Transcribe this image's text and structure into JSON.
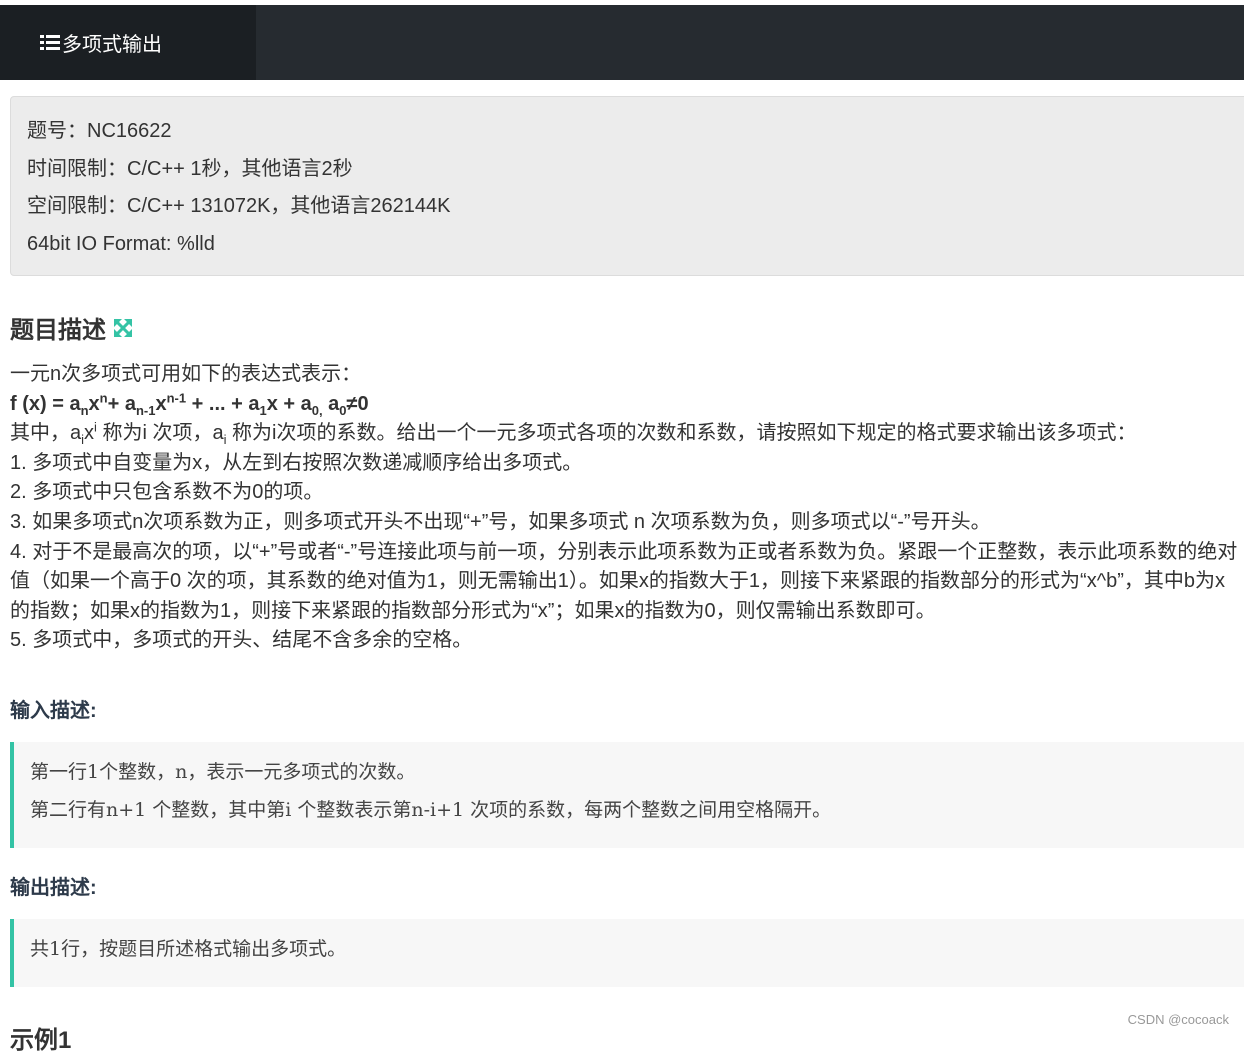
{
  "header": {
    "tab_title": "多项式输出"
  },
  "info": {
    "problem_id": "题号：NC16622",
    "time_limit": "时间限制：C/C++ 1秒，其他语言2秒",
    "memory_limit": "空间限制：C/C++ 131072K，其他语言262144K",
    "io_format": "64bit IO Format: %lld"
  },
  "description": {
    "title": "题目描述",
    "intro": "一元n次多项式可用如下的表达式表示：",
    "formula": {
      "f": "f (x) = a",
      "s1": "n",
      "x1": "x",
      "p1": "n",
      "t1": "+ a",
      "s2": "n-1",
      "x2": "x",
      "p2": "n-1",
      "t2": " + ... + a",
      "s3": "1",
      "t3": "x + a",
      "s4": "0,",
      "t4": " a",
      "s5": "0",
      "t5": "≠0"
    },
    "terms": {
      "a": "其中，a",
      "i1": "i",
      "x": "x",
      "i2": "i",
      "b": " 称为i 次项，a",
      "i3": "i",
      "c": " 称为i次项的系数。给出一个一元多项式各项的次数和系数，请按照如下规定的格式要求输出该多项式："
    },
    "rules": [
      "1. 多项式中自变量为x，从左到右按照次数递减顺序给出多项式。",
      "2. 多项式中只包含系数不为0的项。",
      "3. 如果多项式n次项系数为正，则多项式开头不出现“+”号，如果多项式 n 次项系数为负，则多项式以“-”号开头。",
      "4. 对于不是最高次的项，以“+”号或者“-”号连接此项与前一项，分别表示此项系数为正或者系数为负。紧跟一个正整数，表示此项系数的绝对值（如果一个高于0 次的项，其系数的绝对值为1，则无需输出1）。如果x的指数大于1，则接下来紧跟的指数部分的形式为“x^b”，其中b为x的指数；如果x的指数为1，则接下来紧跟的指数部分形式为“x”；如果x的指数为0，则仅需输出系数即可。",
      "5. 多项式中，多项式的开头、结尾不含多余的空格。"
    ]
  },
  "input": {
    "title": "输入描述:",
    "lines": [
      "第一行1个整数，n，表示一元多项式的次数。",
      "第二行有n+1 个整数，其中第i 个整数表示第n-i+1 次项的系数，每两个整数之间用空格隔开。"
    ]
  },
  "output": {
    "title": "输出描述:",
    "lines": [
      "共1行，按题目所述格式输出多项式。"
    ]
  },
  "example": {
    "title": "示例1"
  },
  "watermark": "CSDN @cocoack",
  "colors": {
    "topbar": "#262b30",
    "active_tab": "#1b1f23",
    "accent": "#34c3a5"
  }
}
